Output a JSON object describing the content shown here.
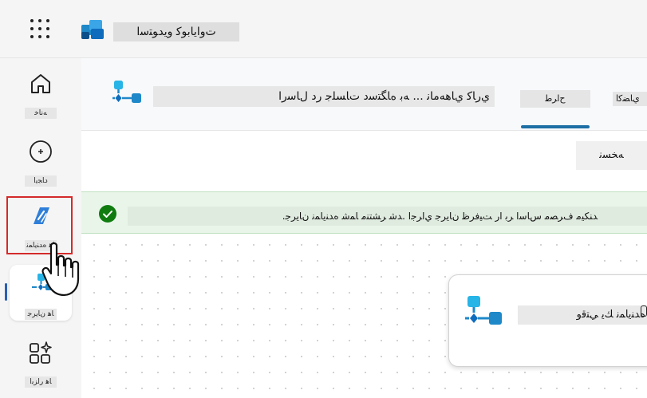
{
  "app": {
    "title": "ﺕﻭﺍﻳﺎﺑﻮﻛ ﻭﻳﺪﻮﺘﺳﺍ"
  },
  "nav": {
    "items": [
      {
        "id": "home",
        "label": "ﻪﻧﺎﺧ",
        "icon": "home-icon"
      },
      {
        "id": "create",
        "label": "ﺩﺎﺠﻳﺍ",
        "icon": "plus-circle-icon"
      },
      {
        "id": "agents",
        "label": "ﺎﻫ ﻩﺪﻨﻳﺎﻤﻧ",
        "icon": "copilot-agent-icon"
      },
      {
        "id": "flows",
        "label": "ﺎﻫ ﻥﺎﻳﺮﺟ",
        "icon": "flow-icon"
      },
      {
        "id": "apps",
        "label": "ﺎﻫ ﺭﺍﺰﺑﺍ",
        "icon": "apps-sparkle-icon"
      }
    ]
  },
  "header": {
    "title": "ﻱﺭﺎﻛ ﻱﺎﻫﻪﻣﺎﻧ ... ﻪﺑ ﻩﺎﮕﺘﺳﺩ ﺕﺎﺴﻠﺟ ﺭﺩ ﻝﺎﺳﺭﺍ",
    "tabs": [
      {
        "label": "ﺡﺍﺮﻃ",
        "active": true
      },
      {
        "label": "ﻱﺎﻀﻛﺍ",
        "active": false
      }
    ]
  },
  "toolbar": {
    "command_label": "ﻪﺨﺴﻧ"
  },
  "banner": {
    "message": "ﺪﻨﻜﻴﻣ ﻑﺮﺼﻣ ﺱﺎﺳﺍ ﺮﺑ ﺍﺭ ﺖﻴﻓﺮﻇ ﻥﺎﻳﺮﺟ ﻱﺍﺮﺟﺍ .ﺪﺷ ﺮﺸﺘﻨﻣ ﺎﻤﺷ ﻩﺪﻨﻳﺎﻤﻧ ﻥﺎﻳﺮﺟ."
  },
  "canvas": {
    "node_label": "ﻩﺪﻨﻳﺎﻤﻧ ﻚﻳ ﻲﺘﻗﻭ"
  },
  "colors": {
    "accent": "#1d6fa5",
    "highlight": "#d42a2a",
    "success": "#107c10"
  }
}
